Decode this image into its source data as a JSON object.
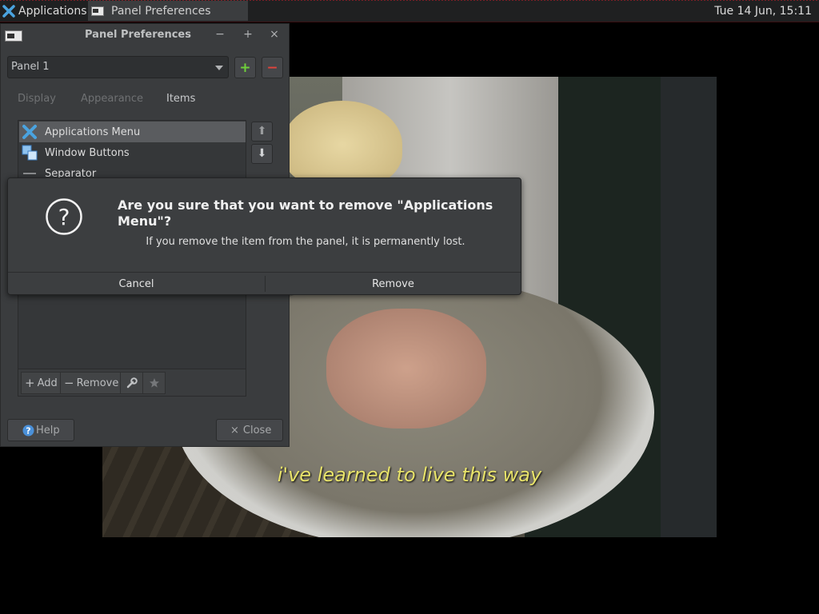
{
  "top_panel": {
    "applications_label": "Applications",
    "task_label": "Panel Preferences",
    "clock": "Tue 14 Jun, 15:11"
  },
  "video": {
    "subtitle": "i've learned to live this way"
  },
  "prefs_window": {
    "title": "Panel Preferences",
    "minimize_glyph": "−",
    "maximize_glyph": "+",
    "close_glyph": "×",
    "panel_select_value": "Panel 1",
    "add_panel_glyph": "+",
    "remove_panel_glyph": "−",
    "tabs": [
      "Display",
      "Appearance",
      "Items"
    ],
    "items": [
      "Applications Menu",
      "Window Buttons",
      "Separator"
    ],
    "toolbar": {
      "add_label": "Add",
      "remove_label": "Remove"
    },
    "help_label": "Help",
    "close_label": "Close"
  },
  "dialog": {
    "primary": "Are you sure that you want to remove \"Applications Menu\"?",
    "secondary": "If you remove the item from the panel, it is permanently lost.",
    "cancel_label": "Cancel",
    "remove_label": "Remove"
  },
  "colors": {
    "accent_add": "#6fd03a",
    "accent_remove": "#e0443c",
    "subtitle": "#e8e36a"
  }
}
